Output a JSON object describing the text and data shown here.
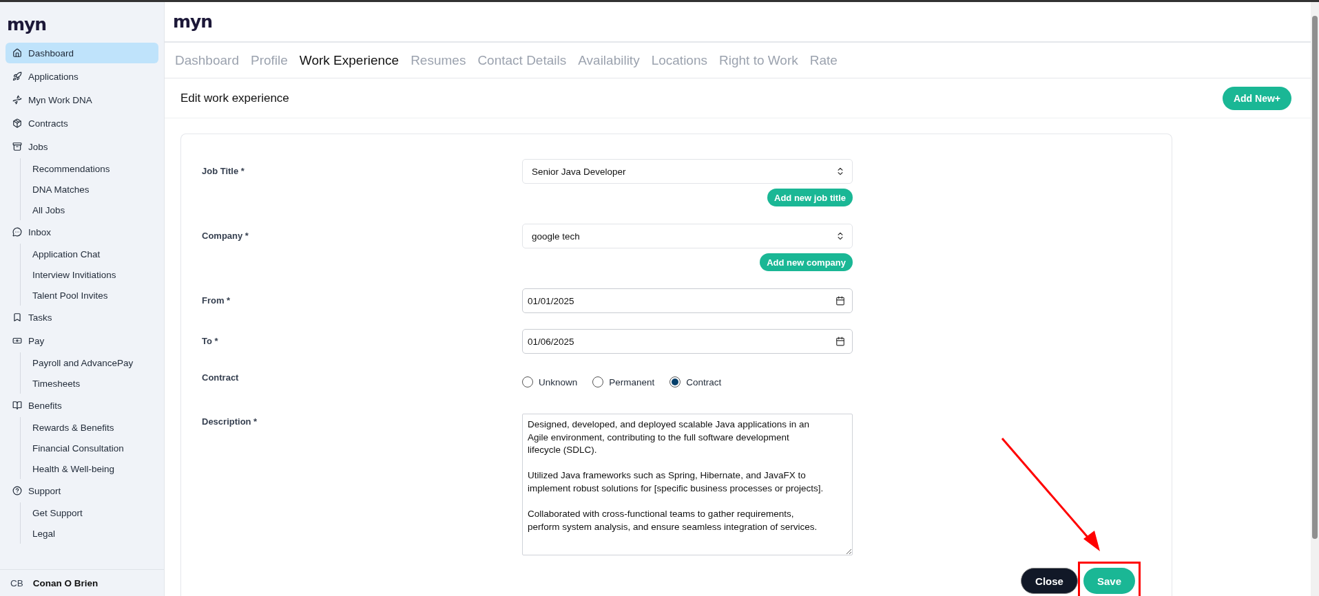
{
  "sidebar": {
    "logo": "myn",
    "items": [
      {
        "label": "Dashboard",
        "selected": true
      },
      {
        "label": "Applications",
        "selected": false
      },
      {
        "label": "Myn Work DNA",
        "selected": false
      },
      {
        "label": "Contracts",
        "selected": false
      },
      {
        "label": "Jobs",
        "selected": false,
        "children": [
          {
            "label": "Recommendations",
            "selected": false
          },
          {
            "label": "DNA Matches",
            "selected": false
          },
          {
            "label": "All Jobs",
            "selected": false
          }
        ]
      },
      {
        "label": "Inbox",
        "selected": false,
        "children": [
          {
            "label": "Application Chat",
            "selected": false
          },
          {
            "label": "Interview Invitiations",
            "selected": false
          },
          {
            "label": "Talent Pool Invites",
            "selected": false
          }
        ]
      },
      {
        "label": "Tasks",
        "selected": false
      },
      {
        "label": "Pay",
        "selected": false,
        "children": [
          {
            "label": "Payroll and AdvancePay",
            "selected": false
          },
          {
            "label": "Timesheets",
            "selected": false
          }
        ]
      },
      {
        "label": "Benefits",
        "selected": false,
        "children": [
          {
            "label": "Rewards & Benefits",
            "selected": false
          },
          {
            "label": "Financial Consultation",
            "selected": false
          },
          {
            "label": "Health & Well-being",
            "selected": false
          }
        ]
      },
      {
        "label": "Support",
        "selected": false,
        "children": [
          {
            "label": "Get Support",
            "selected": false
          },
          {
            "label": "Legal",
            "selected": false
          }
        ]
      }
    ],
    "user": {
      "initials": "CB",
      "name": "Conan O Brien"
    }
  },
  "header": {
    "logo": "myn"
  },
  "tabs": [
    {
      "label": "Dashboard",
      "selected": false
    },
    {
      "label": "Profile",
      "selected": false
    },
    {
      "label": "Work Experience",
      "selected": true
    },
    {
      "label": "Resumes",
      "selected": false
    },
    {
      "label": "Contact Details",
      "selected": false
    },
    {
      "label": "Availability",
      "selected": false
    },
    {
      "label": "Locations",
      "selected": false
    },
    {
      "label": "Right to Work",
      "selected": false
    },
    {
      "label": "Rate",
      "selected": false
    }
  ],
  "section": {
    "title": "Edit work experience",
    "add_button": "Add New+"
  },
  "form": {
    "fields": [
      {
        "kind": "select",
        "label": "Job Title *",
        "value": "Senior Java Developer",
        "action": "Add new job title"
      },
      {
        "kind": "select",
        "label": "Company *",
        "value": "google tech",
        "action": "Add new company"
      },
      {
        "kind": "date",
        "label": "From *",
        "value": "01/01/2025"
      },
      {
        "kind": "date",
        "label": "To *",
        "value": "01/06/2025"
      },
      {
        "kind": "radio",
        "label": "Contract",
        "options": [
          {
            "label": "Unknown",
            "selected": false
          },
          {
            "label": "Permanent",
            "selected": false
          },
          {
            "label": "Contract",
            "selected": true
          }
        ]
      },
      {
        "kind": "textarea",
        "label": "Description *",
        "value": "Designed, developed, and deployed scalable Java applications in an Agile environment, contributing to the full software development lifecycle (SDLC).\n\nUtilized Java frameworks such as Spring, Hibernate, and JavaFX to implement robust solutions for [specific business processes or projects].\n\nCollaborated with cross-functional teams to gather requirements, perform system analysis, and ensure seamless integration of services."
      }
    ],
    "actions": [
      {
        "kind": "secondary",
        "label": "Close"
      },
      {
        "kind": "primary",
        "label": "Save"
      }
    ]
  }
}
